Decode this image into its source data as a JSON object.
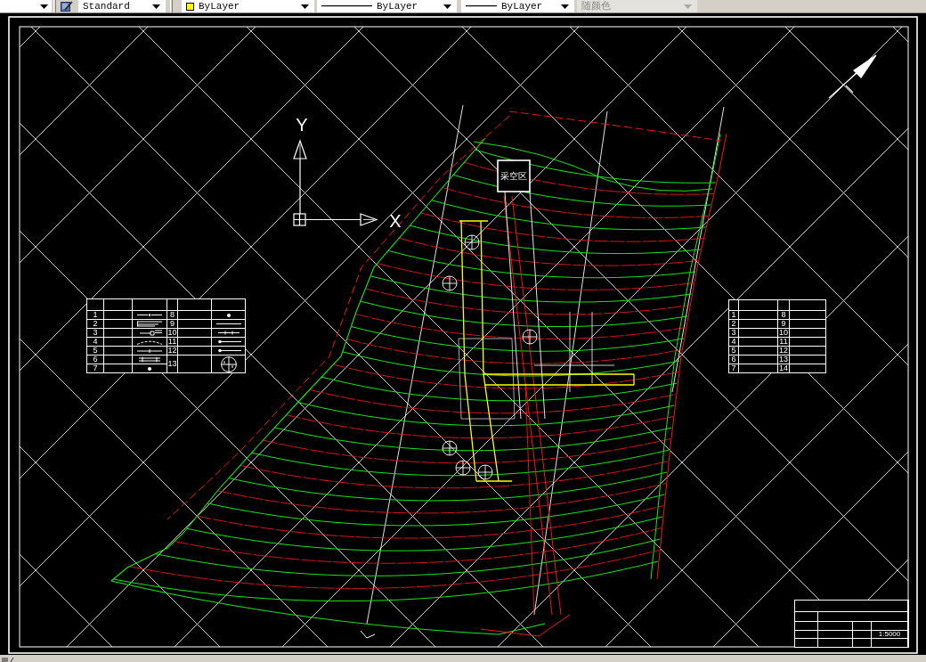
{
  "toolbar": {
    "controls": [
      {
        "kind": "text-style",
        "value": "Standard",
        "disabled": false
      },
      {
        "kind": "layer",
        "value": "ByLayer",
        "disabled": false
      },
      {
        "kind": "linetype",
        "value": "ByLayer",
        "disabled": false
      },
      {
        "kind": "lineweight",
        "value": "ByLayer",
        "disabled": false
      },
      {
        "kind": "plot-style",
        "value": "随颜色",
        "disabled": true
      }
    ]
  },
  "drawing": {
    "ucs_icon": {
      "y_label": "Y",
      "x_label": "X"
    },
    "area_label": "采空区",
    "legend_table": {
      "items": [
        {
          "number": "1",
          "kind": "dot-line"
        },
        {
          "number": "2",
          "kind": "double-line"
        },
        {
          "number": "3",
          "kind": "tagged-line"
        },
        {
          "number": "4",
          "kind": "arc"
        },
        {
          "number": "5",
          "kind": "tick-line"
        },
        {
          "number": "6",
          "kind": "double-tick"
        },
        {
          "number": "7",
          "kind": "dot"
        },
        {
          "number": "8",
          "kind": "dot"
        },
        {
          "number": "9",
          "kind": "line"
        },
        {
          "number": "10",
          "kind": "dash-line"
        },
        {
          "number": "11",
          "kind": "pin-line"
        },
        {
          "number": "12",
          "kind": "pin-line"
        },
        {
          "number": "13",
          "kind": "compass"
        }
      ]
    },
    "notes_table": {
      "items": [
        {
          "number": "1"
        },
        {
          "number": "2"
        },
        {
          "number": "3"
        },
        {
          "number": "4"
        },
        {
          "number": "5"
        },
        {
          "number": "6"
        },
        {
          "number": "7"
        },
        {
          "number": "8"
        },
        {
          "number": "9"
        },
        {
          "number": "10"
        },
        {
          "number": "11"
        },
        {
          "number": "12"
        },
        {
          "number": "13"
        },
        {
          "number": "14"
        }
      ]
    },
    "title_block": {
      "scale": "1:5000"
    }
  }
}
